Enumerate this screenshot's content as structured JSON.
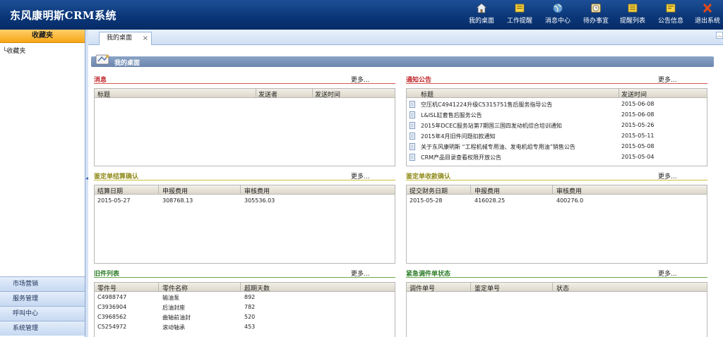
{
  "header": {
    "title": "东风康明斯CRM系统",
    "nav": [
      {
        "label": "我的桌面",
        "icon": "home-icon"
      },
      {
        "label": "工作提醒",
        "icon": "reminder-icon"
      },
      {
        "label": "消息中心",
        "icon": "globe-icon"
      },
      {
        "label": "待办事宜",
        "icon": "clock-icon"
      },
      {
        "label": "提醒列表",
        "icon": "list-icon"
      },
      {
        "label": "公告信息",
        "icon": "notice-icon"
      },
      {
        "label": "退出系统",
        "icon": "close-icon"
      }
    ]
  },
  "sidebar": {
    "favorites_header": "收藏夹",
    "favorites_item": "└收藏夹",
    "menu": [
      "市场营销",
      "服务管理",
      "呼叫中心",
      "系统管理"
    ]
  },
  "tabs": {
    "active": "我的桌面",
    "close": "×",
    "scroll": "︿"
  },
  "desktop": {
    "title": "我的桌面"
  },
  "colors": {
    "header": "#0a3577",
    "sidebar_active": "#f7a617",
    "desk_bar": "#7a93b9",
    "red": "#c0282d",
    "green": "#2f7e2a",
    "olive": "#8f8a1a"
  },
  "more_label": "更多...",
  "panels": {
    "messages": {
      "title": "消息",
      "headers": [
        "标题",
        "发送者",
        "发送时间"
      ],
      "rows": []
    },
    "notices": {
      "title": "通知公告",
      "headers": [
        "标题",
        "发送时间"
      ],
      "rows": [
        [
          "空压机C4941224升级C5315751售后服务指导公告",
          "2015-06-08"
        ],
        [
          "L&ISL缸套售后服务公告",
          "2015-06-08"
        ],
        [
          "2015年DCEC服务站第7期国三国四发动机综合培训通知",
          "2015-05-26"
        ],
        [
          "2015年4月旧件问题扣款通知",
          "2015-05-11"
        ],
        [
          "关于东风康明斯 “工程机械专用油、发电机组专用油”销售公告",
          "2015-05-08"
        ],
        [
          "CRM产品目录查看权限开放公告",
          "2015-05-04"
        ]
      ]
    },
    "settlement": {
      "title": "鉴定单结算确认",
      "headers": [
        "结算日期",
        "申报费用",
        "审核费用"
      ],
      "rows": [
        [
          "2015-05-27",
          "308768.13",
          "305536.03"
        ]
      ]
    },
    "payment": {
      "title": "鉴定单收款确认",
      "headers": [
        "提交财务日期",
        "申报费用",
        "审核费用"
      ],
      "rows": [
        [
          "2015-05-28",
          "416028.25",
          "400276.0"
        ]
      ]
    },
    "oldparts": {
      "title": "旧件列表",
      "headers": [
        "零件号",
        "零件名称",
        "超期天数"
      ],
      "rows": [
        [
          "C4988747",
          "输油泵",
          "892"
        ],
        [
          "C3936904",
          "后油封座",
          "782"
        ],
        [
          "C3968562",
          "曲轴前油封",
          "520"
        ],
        [
          "C5254972",
          "滚动轴承",
          "453"
        ]
      ]
    },
    "urgent": {
      "title": "紧急调件单状态",
      "headers": [
        "调件单号",
        "鉴定单号",
        "状态"
      ],
      "rows": []
    }
  }
}
